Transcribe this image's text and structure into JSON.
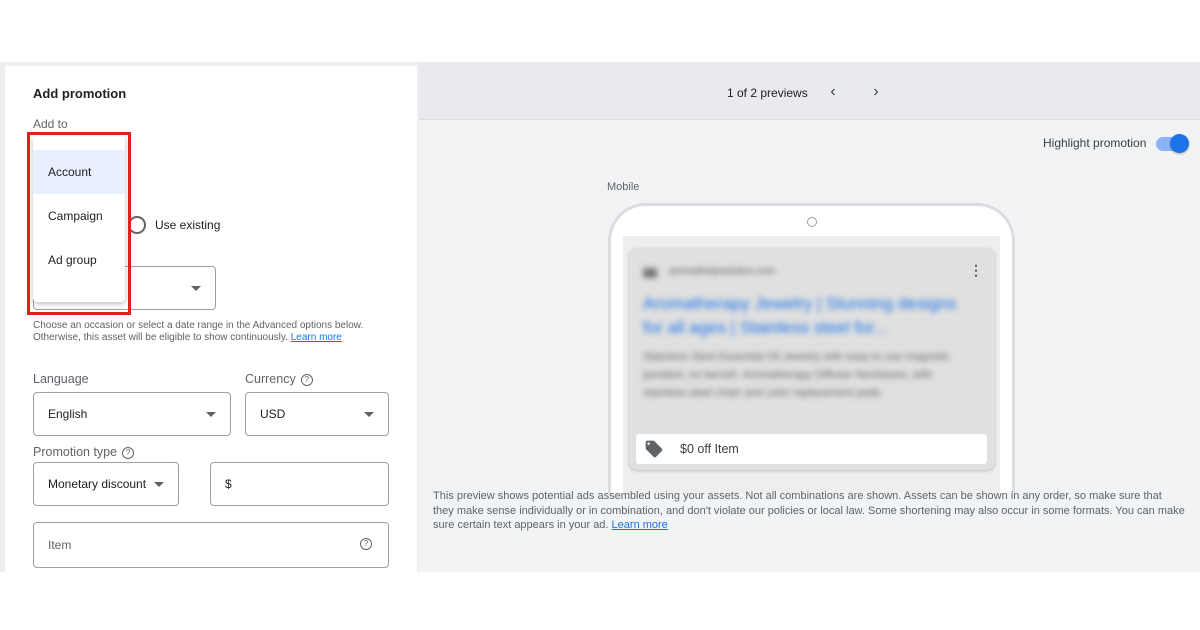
{
  "form": {
    "title": "Add promotion",
    "add_to_label": "Add to",
    "add_to_options": [
      "Account",
      "Campaign",
      "Ad group"
    ],
    "use_existing_label": "Use existing",
    "occasion_helper": "Choose an occasion or select a date range in the Advanced options below. Otherwise, this asset will be eligible to show continuously.",
    "learn_more": "Learn more",
    "language_label": "Language",
    "language_value": "English",
    "currency_label": "Currency",
    "currency_value": "USD",
    "promotion_type_label": "Promotion type",
    "promotion_type_value": "Monetary discount",
    "amount_prefix": "$",
    "item_placeholder": "Item"
  },
  "preview": {
    "pager_text": "1 of 2 previews",
    "highlight_label": "Highlight promotion",
    "highlight_on": true,
    "device_label": "Mobile",
    "ad_url": "aromathelpsolution.com",
    "ad_headline": "Aromatherapy Jewelry | Stunning designs for all ages | Stainless steel for...",
    "ad_description": "Stainless Steel Essential Oil Jewelry with easy to use magnetic pendant, no tarnish. Aromatherapy Diffuser Necklaces, with stainless steel chain and color replacement pads.",
    "promo_text": "$0 off Item",
    "disclaimer": "This preview shows potential ads assembled using your assets. Not all combinations are shown. Assets can be shown in any order, so make sure that they make sense individually or in combination, and don't violate our policies or local law. Some shortening may also occur in some formats. You can make sure certain text appears in your ad.",
    "learn_more": "Learn more"
  },
  "colors": {
    "accent": "#1a73e8",
    "highlight_box": "#e0201b"
  },
  "icons": [
    "chevron-left-icon",
    "chevron-right-icon",
    "help-icon",
    "tag-icon",
    "more-vert-icon",
    "dropdown-caret-icon"
  ]
}
